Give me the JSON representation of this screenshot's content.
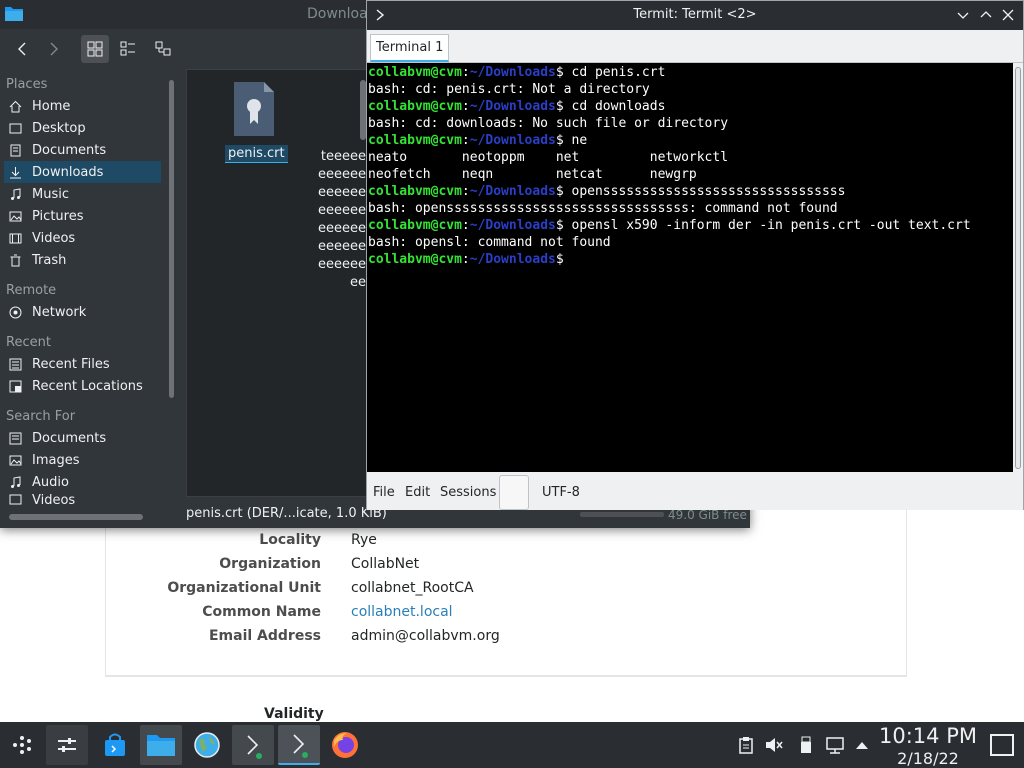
{
  "certificate": {
    "fields": [
      {
        "label": "Locality",
        "value": "Rye"
      },
      {
        "label": "Organization",
        "value": "CollabNet"
      },
      {
        "label": "Organizational Unit",
        "value": "collabnet_RootCA"
      },
      {
        "label": "Common Name",
        "value": "collabnet.local"
      },
      {
        "label": "Email Address",
        "value": "admin@collabvm.org"
      }
    ],
    "validity_heading": "Validity"
  },
  "dolphin": {
    "title": "Download",
    "places": {
      "places_heading": "Places",
      "places": [
        "Home",
        "Desktop",
        "Documents",
        "Downloads",
        "Music",
        "Pictures",
        "Videos",
        "Trash"
      ],
      "remote_heading": "Remote",
      "remote": [
        "Network"
      ],
      "recent_heading": "Recent",
      "recent": [
        "Recent Files",
        "Recent Locations"
      ],
      "search_heading": "Search For",
      "search": [
        "Documents",
        "Images",
        "Audio",
        "Videos"
      ]
    },
    "file": {
      "name": "penis.crt"
    },
    "e_lines": [
      "teeeee",
      "eeeeee",
      "eeeeee",
      "eeeeee",
      "eeeeee",
      "eeeeee",
      "eeeeee",
      "ee"
    ],
    "status": "penis.crt (DER/...icate, 1.0 KiB)",
    "free_space": "49.0 GiB free"
  },
  "termit": {
    "title": "Termit: Termit <2>",
    "tab": "Terminal 1",
    "prompt_user": "collabvm@cvm",
    "prompt_path": "~/Downloads",
    "lines": [
      {
        "type": "prompt",
        "cmd": " cd penis.crt"
      },
      {
        "type": "out",
        "text": "bash: cd: penis.crt: Not a directory"
      },
      {
        "type": "prompt",
        "cmd": " cd downloads"
      },
      {
        "type": "out",
        "text": "bash: cd: downloads: No such file or directory"
      },
      {
        "type": "prompt",
        "cmd": " ne"
      },
      {
        "type": "out",
        "text": "neato       neotoppm    net         networkctl"
      },
      {
        "type": "out",
        "text": "neofetch    neqn        netcat      newgrp"
      },
      {
        "type": "prompt",
        "cmd": " opensssssssssssssssssssssssssssssss"
      },
      {
        "type": "out",
        "text": "bash: opensssssssssssssssssssssssssssssss: command not found"
      },
      {
        "type": "prompt",
        "cmd": " opensl x590 -inform der -in penis.crt -out text.crt"
      },
      {
        "type": "out",
        "text": "bash: opensl: command not found"
      },
      {
        "type": "prompt",
        "cmd": ""
      }
    ],
    "menu": [
      "File",
      "Edit",
      "Sessions"
    ],
    "encoding": "UTF-8"
  },
  "taskbar": {
    "time": "10:14 PM",
    "date": "2/18/22"
  },
  "colors": {
    "accent": "#3daee9",
    "prompt_user": "#34e234",
    "prompt_path": "#2a3ec6",
    "link": "#2980b9"
  }
}
